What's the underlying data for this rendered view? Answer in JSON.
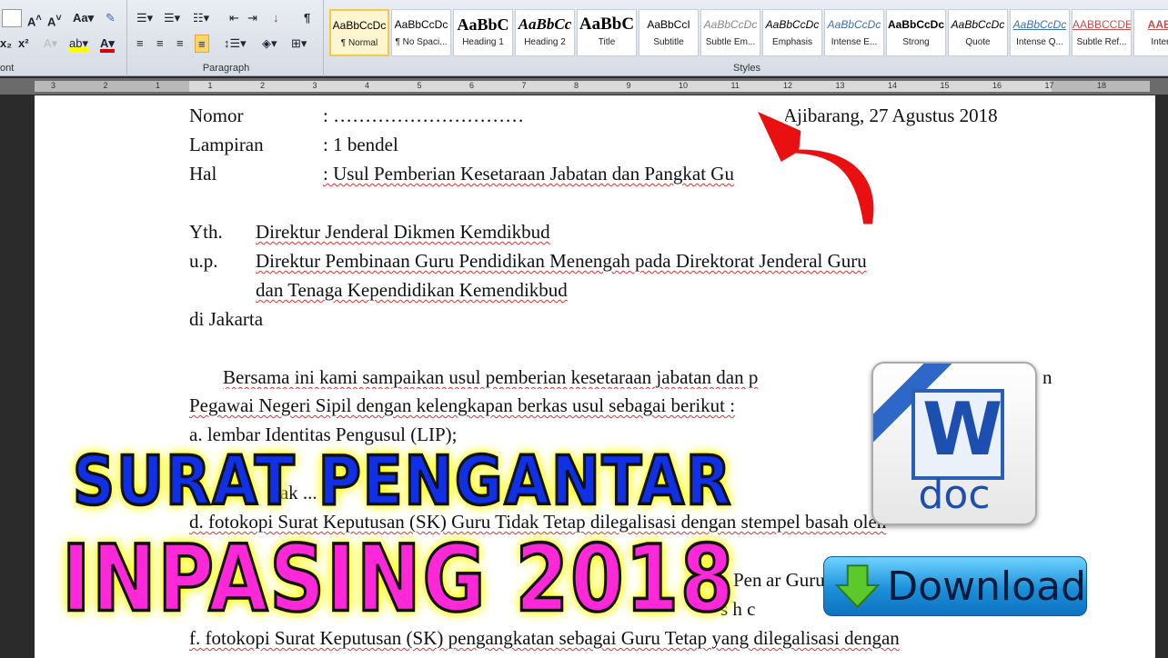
{
  "ribbon": {
    "font_group_label": "ont",
    "paragraph_group_label": "Paragraph",
    "styles_group_label": "Styles",
    "styles": [
      {
        "sample": "AaBbCcDc",
        "name": "¶ Normal",
        "selected": true
      },
      {
        "sample": "AaBbCcDc",
        "name": "¶ No Spaci..."
      },
      {
        "sample": "AaBbC",
        "name": "Heading 1"
      },
      {
        "sample": "AaBbCc",
        "name": "Heading 2"
      },
      {
        "sample": "AaBbC",
        "name": "Title"
      },
      {
        "sample": "AaBbCcI",
        "name": "Subtitle"
      },
      {
        "sample": "AaBbCcDc",
        "name": "Subtle Em..."
      },
      {
        "sample": "AaBbCcDc",
        "name": "Emphasis"
      },
      {
        "sample": "AaBbCcDc",
        "name": "Intense E..."
      },
      {
        "sample": "AaBbCcDc",
        "name": "Strong"
      },
      {
        "sample": "AaBbCcDc",
        "name": "Quote"
      },
      {
        "sample": "AaBbCcDc",
        "name": "Intense Q..."
      },
      {
        "sample": "AABBCCDE",
        "name": "Subtle Ref..."
      },
      {
        "sample": "AABB",
        "name": "Intens"
      }
    ]
  },
  "ruler": {
    "ticks": [
      "3",
      "2",
      "1",
      "1",
      "2",
      "3",
      "4",
      "5",
      "6",
      "7",
      "8",
      "9",
      "10",
      "11",
      "12",
      "13",
      "14",
      "15",
      "16",
      "17",
      "18"
    ]
  },
  "letter": {
    "nomor_label": "Nomor",
    "nomor_value": ": …………………………",
    "date": "Ajibarang, 27 Agustus 2018",
    "lampiran_label": "Lampiran",
    "lampiran_value": ": 1 bendel",
    "hal_label": "Hal",
    "hal_value": ": Usul Pemberian Kesetaraan Jabatan dan Pangkat Gu",
    "yth": "Yth.",
    "yth_value": "Direktur Jenderal Dikmen Kemdikbud",
    "up": "u.p.",
    "up_value": "Direktur Pembinaan Guru Pendidikan Menengah pada Direktorat Jenderal Guru",
    "up_value2": "dan Tenaga Kependidikan Kemendikbud",
    "place": "di Jakarta",
    "para1": "Bersama ini kami sampaikan usul pemberian kesetaraan jabatan dan p",
    "para1_end": "n",
    "para2": "Pegawai Negeri Sipil dengan kelengkapan berkas usul sebagai berikut :",
    "item_a": "a.   lembar Identitas Pengusul (LIP);",
    "item_c_frag": "tak  ...",
    "item_d": "d.   fotokopi Surat Keputusan (SK) Guru Tidak Tetap dilegalisasi dengan stempel basah oleh",
    "item_e_frag1": "Pen",
    "item_e_frag2": "ar Guru",
    "item_e2_frag": "s          h c",
    "item_f": "f.    fotokopi Surat Keputusan (SK) pengangkatan sebagai Guru Tetap yang dilegalisasi dengan"
  },
  "overlay": {
    "title1": "SURAT PENGANTAR",
    "title2": "INPASING 2018",
    "title1_color": "#1030e8",
    "title2_color": "#ff28d8",
    "glow_color": "#ffff00",
    "word_icon_letter": "W",
    "word_icon_label": "doc",
    "download_label": "Download"
  }
}
